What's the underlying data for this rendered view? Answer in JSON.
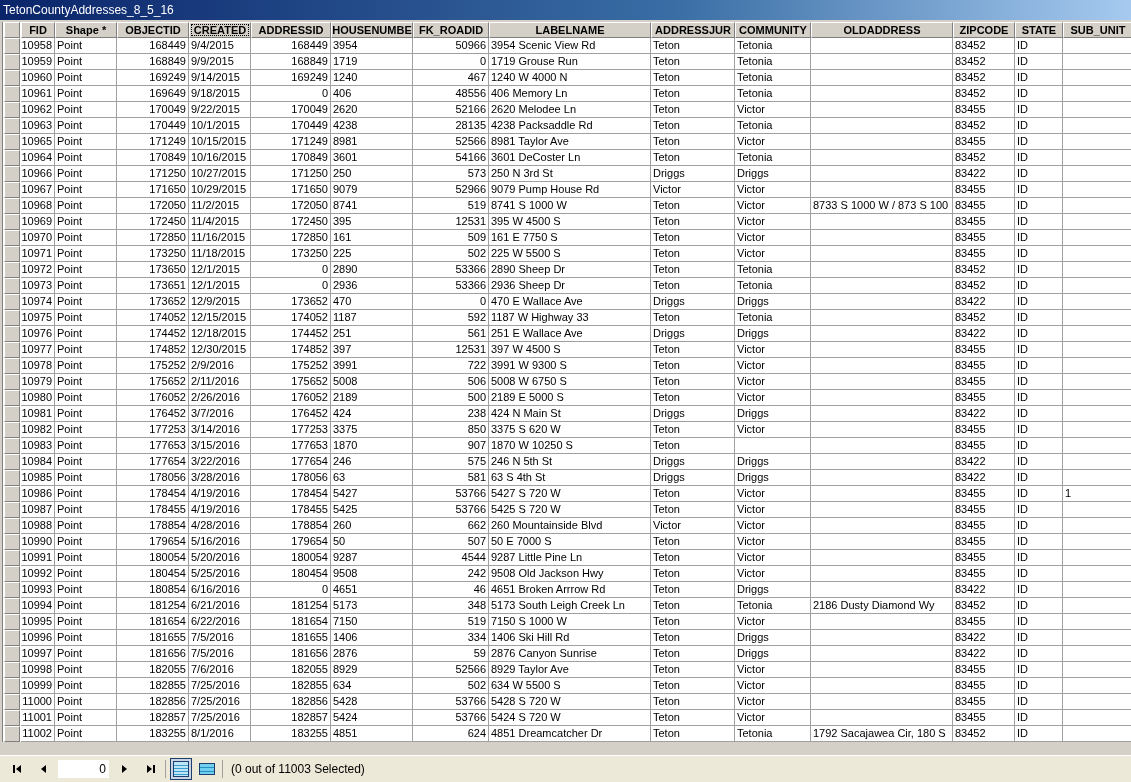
{
  "window": {
    "title": "TetonCountyAddresses_8_5_16"
  },
  "table": {
    "columns": [
      {
        "label": "FID",
        "kind": "number",
        "focused": false
      },
      {
        "label": "Shape *",
        "kind": "text",
        "focused": false
      },
      {
        "label": "OBJECTID",
        "kind": "number",
        "focused": false
      },
      {
        "label": "CREATED",
        "kind": "text",
        "focused": true
      },
      {
        "label": "ADDRESSID",
        "kind": "number",
        "focused": false
      },
      {
        "label": "HOUSENUMBE",
        "kind": "text",
        "focused": false
      },
      {
        "label": "FK_ROADID",
        "kind": "number",
        "focused": false
      },
      {
        "label": "LABELNAME",
        "kind": "text",
        "focused": false
      },
      {
        "label": "ADDRESSJUR",
        "kind": "text",
        "focused": false
      },
      {
        "label": "COMMUNITY",
        "kind": "text",
        "focused": false
      },
      {
        "label": "OLDADDRESS",
        "kind": "text",
        "focused": false
      },
      {
        "label": "ZIPCODE",
        "kind": "text",
        "focused": false
      },
      {
        "label": "STATE",
        "kind": "text",
        "focused": false
      },
      {
        "label": "SUB_UNIT",
        "kind": "text",
        "focused": false
      }
    ],
    "rows": [
      {
        "fid": "10958",
        "shape": "Point",
        "objectid": "168449",
        "created": "9/4/2015",
        "addressid": "168449",
        "housenumbe": "3954",
        "fk_roadid": "50966",
        "labelname": "3954 Scenic View Rd",
        "addressjur": "Teton",
        "community": "Tetonia",
        "zipcode": "83452",
        "state": "ID"
      },
      {
        "fid": "10959",
        "shape": "Point",
        "objectid": "168849",
        "created": "9/9/2015",
        "addressid": "168849",
        "housenumbe": "1719",
        "fk_roadid": "0",
        "labelname": "1719 Grouse Run",
        "addressjur": "Teton",
        "community": "Tetonia",
        "zipcode": "83452",
        "state": "ID"
      },
      {
        "fid": "10960",
        "shape": "Point",
        "objectid": "169249",
        "created": "9/14/2015",
        "addressid": "169249",
        "housenumbe": "1240",
        "fk_roadid": "467",
        "labelname": "1240 W 4000 N",
        "addressjur": "Teton",
        "community": "Tetonia",
        "zipcode": "83452",
        "state": "ID"
      },
      {
        "fid": "10961",
        "shape": "Point",
        "objectid": "169649",
        "created": "9/18/2015",
        "addressid": "0",
        "housenumbe": "406",
        "fk_roadid": "48556",
        "labelname": "406 Memory Ln",
        "addressjur": "Teton",
        "community": "Tetonia",
        "zipcode": "83452",
        "state": "ID"
      },
      {
        "fid": "10962",
        "shape": "Point",
        "objectid": "170049",
        "created": "9/22/2015",
        "addressid": "170049",
        "housenumbe": "2620",
        "fk_roadid": "52166",
        "labelname": "2620 Melodee Ln",
        "addressjur": "Teton",
        "community": "Victor",
        "zipcode": "83455",
        "state": "ID"
      },
      {
        "fid": "10963",
        "shape": "Point",
        "objectid": "170449",
        "created": "10/1/2015",
        "addressid": "170449",
        "housenumbe": "4238",
        "fk_roadid": "28135",
        "labelname": "4238 Packsaddle Rd",
        "addressjur": "Teton",
        "community": "Tetonia",
        "zipcode": "83452",
        "state": "ID"
      },
      {
        "fid": "10965",
        "shape": "Point",
        "objectid": "171249",
        "created": "10/15/2015",
        "addressid": "171249",
        "housenumbe": "8981",
        "fk_roadid": "52566",
        "labelname": "8981 Taylor Ave",
        "addressjur": "Teton",
        "community": "Victor",
        "zipcode": "83455",
        "state": "ID"
      },
      {
        "fid": "10964",
        "shape": "Point",
        "objectid": "170849",
        "created": "10/16/2015",
        "addressid": "170849",
        "housenumbe": "3601",
        "fk_roadid": "54166",
        "labelname": "3601 DeCoster Ln",
        "addressjur": "Teton",
        "community": "Tetonia",
        "zipcode": "83452",
        "state": "ID"
      },
      {
        "fid": "10966",
        "shape": "Point",
        "objectid": "171250",
        "created": "10/27/2015",
        "addressid": "171250",
        "housenumbe": "250",
        "fk_roadid": "573",
        "labelname": "250 N 3rd St",
        "addressjur": "Driggs",
        "community": "Driggs",
        "zipcode": "83422",
        "state": "ID"
      },
      {
        "fid": "10967",
        "shape": "Point",
        "objectid": "171650",
        "created": "10/29/2015",
        "addressid": "171650",
        "housenumbe": "9079",
        "fk_roadid": "52966",
        "labelname": "9079 Pump House Rd",
        "addressjur": "Victor",
        "community": "Victor",
        "zipcode": "83455",
        "state": "ID"
      },
      {
        "fid": "10968",
        "shape": "Point",
        "objectid": "172050",
        "created": "11/2/2015",
        "addressid": "172050",
        "housenumbe": "8741",
        "fk_roadid": "519",
        "labelname": "8741 S 1000 W",
        "addressjur": "Teton",
        "community": "Victor",
        "oldaddress": "8733 S 1000 W / 873 S 100",
        "zipcode": "83455",
        "state": "ID"
      },
      {
        "fid": "10969",
        "shape": "Point",
        "objectid": "172450",
        "created": "11/4/2015",
        "addressid": "172450",
        "housenumbe": "395",
        "fk_roadid": "12531",
        "labelname": "395 W 4500 S",
        "addressjur": "Teton",
        "community": "Victor",
        "zipcode": "83455",
        "state": "ID"
      },
      {
        "fid": "10970",
        "shape": "Point",
        "objectid": "172850",
        "created": "11/16/2015",
        "addressid": "172850",
        "housenumbe": "161",
        "fk_roadid": "509",
        "labelname": "161 E 7750 S",
        "addressjur": "Teton",
        "community": "Victor",
        "zipcode": "83455",
        "state": "ID"
      },
      {
        "fid": "10971",
        "shape": "Point",
        "objectid": "173250",
        "created": "11/18/2015",
        "addressid": "173250",
        "housenumbe": "225",
        "fk_roadid": "502",
        "labelname": "225 W 5500 S",
        "addressjur": "Teton",
        "community": "Victor",
        "zipcode": "83455",
        "state": "ID"
      },
      {
        "fid": "10972",
        "shape": "Point",
        "objectid": "173650",
        "created": "12/1/2015",
        "addressid": "0",
        "housenumbe": "2890",
        "fk_roadid": "53366",
        "labelname": "2890 Sheep Dr",
        "addressjur": "Teton",
        "community": "Tetonia",
        "zipcode": "83452",
        "state": "ID"
      },
      {
        "fid": "10973",
        "shape": "Point",
        "objectid": "173651",
        "created": "12/1/2015",
        "addressid": "0",
        "housenumbe": "2936",
        "fk_roadid": "53366",
        "labelname": "2936 Sheep Dr",
        "addressjur": "Teton",
        "community": "Tetonia",
        "zipcode": "83452",
        "state": "ID"
      },
      {
        "fid": "10974",
        "shape": "Point",
        "objectid": "173652",
        "created": "12/9/2015",
        "addressid": "173652",
        "housenumbe": "470",
        "fk_roadid": "0",
        "labelname": "470 E Wallace Ave",
        "addressjur": "Driggs",
        "community": "Driggs",
        "zipcode": "83422",
        "state": "ID"
      },
      {
        "fid": "10975",
        "shape": "Point",
        "objectid": "174052",
        "created": "12/15/2015",
        "addressid": "174052",
        "housenumbe": "1187",
        "fk_roadid": "592",
        "labelname": "1187 W Highway 33",
        "addressjur": "Teton",
        "community": "Tetonia",
        "zipcode": "83452",
        "state": "ID"
      },
      {
        "fid": "10976",
        "shape": "Point",
        "objectid": "174452",
        "created": "12/18/2015",
        "addressid": "174452",
        "housenumbe": "251",
        "fk_roadid": "561",
        "labelname": "251 E Wallace Ave",
        "addressjur": "Driggs",
        "community": "Driggs",
        "zipcode": "83422",
        "state": "ID"
      },
      {
        "fid": "10977",
        "shape": "Point",
        "objectid": "174852",
        "created": "12/30/2015",
        "addressid": "174852",
        "housenumbe": "397",
        "fk_roadid": "12531",
        "labelname": "397 W 4500 S",
        "addressjur": "Teton",
        "community": "Victor",
        "zipcode": "83455",
        "state": "ID"
      },
      {
        "fid": "10978",
        "shape": "Point",
        "objectid": "175252",
        "created": "2/9/2016",
        "addressid": "175252",
        "housenumbe": "3991",
        "fk_roadid": "722",
        "labelname": "3991 W 9300 S",
        "addressjur": "Teton",
        "community": "Victor",
        "zipcode": "83455",
        "state": "ID"
      },
      {
        "fid": "10979",
        "shape": "Point",
        "objectid": "175652",
        "created": "2/11/2016",
        "addressid": "175652",
        "housenumbe": "5008",
        "fk_roadid": "506",
        "labelname": "5008 W 6750 S",
        "addressjur": "Teton",
        "community": "Victor",
        "zipcode": "83455",
        "state": "ID"
      },
      {
        "fid": "10980",
        "shape": "Point",
        "objectid": "176052",
        "created": "2/26/2016",
        "addressid": "176052",
        "housenumbe": "2189",
        "fk_roadid": "500",
        "labelname": "2189 E 5000 S",
        "addressjur": "Teton",
        "community": "Victor",
        "zipcode": "83455",
        "state": "ID"
      },
      {
        "fid": "10981",
        "shape": "Point",
        "objectid": "176452",
        "created": "3/7/2016",
        "addressid": "176452",
        "housenumbe": "424",
        "fk_roadid": "238",
        "labelname": "424 N Main St",
        "addressjur": "Driggs",
        "community": "Driggs",
        "zipcode": "83422",
        "state": "ID"
      },
      {
        "fid": "10982",
        "shape": "Point",
        "objectid": "177253",
        "created": "3/14/2016",
        "addressid": "177253",
        "housenumbe": "3375",
        "fk_roadid": "850",
        "labelname": "3375 S 620 W",
        "addressjur": "Teton",
        "community": "Victor",
        "zipcode": "83455",
        "state": "ID"
      },
      {
        "fid": "10983",
        "shape": "Point",
        "objectid": "177653",
        "created": "3/15/2016",
        "addressid": "177653",
        "housenumbe": "1870",
        "fk_roadid": "907",
        "labelname": "1870 W 10250 S",
        "addressjur": "Teton",
        "zipcode": "83455",
        "state": "ID"
      },
      {
        "fid": "10984",
        "shape": "Point",
        "objectid": "177654",
        "created": "3/22/2016",
        "addressid": "177654",
        "housenumbe": "246",
        "fk_roadid": "575",
        "labelname": "246 N 5th St",
        "addressjur": "Driggs",
        "community": "Driggs",
        "zipcode": "83422",
        "state": "ID"
      },
      {
        "fid": "10985",
        "shape": "Point",
        "objectid": "178056",
        "created": "3/28/2016",
        "addressid": "178056",
        "housenumbe": "63",
        "fk_roadid": "581",
        "labelname": "63 S 4th St",
        "addressjur": "Driggs",
        "community": "Driggs",
        "zipcode": "83422",
        "state": "ID"
      },
      {
        "fid": "10986",
        "shape": "Point",
        "objectid": "178454",
        "created": "4/19/2016",
        "addressid": "178454",
        "housenumbe": "5427",
        "fk_roadid": "53766",
        "labelname": "5427 S 720 W",
        "addressjur": "Teton",
        "community": "Victor",
        "zipcode": "83455",
        "state": "ID",
        "sub_unit": "1"
      },
      {
        "fid": "10987",
        "shape": "Point",
        "objectid": "178455",
        "created": "4/19/2016",
        "addressid": "178455",
        "housenumbe": "5425",
        "fk_roadid": "53766",
        "labelname": "5425 S 720 W",
        "addressjur": "Teton",
        "community": "Victor",
        "zipcode": "83455",
        "state": "ID"
      },
      {
        "fid": "10988",
        "shape": "Point",
        "objectid": "178854",
        "created": "4/28/2016",
        "addressid": "178854",
        "housenumbe": "260",
        "fk_roadid": "662",
        "labelname": "260 Mountainside Blvd",
        "addressjur": "Victor",
        "community": "Victor",
        "zipcode": "83455",
        "state": "ID"
      },
      {
        "fid": "10990",
        "shape": "Point",
        "objectid": "179654",
        "created": "5/16/2016",
        "addressid": "179654",
        "housenumbe": "50",
        "fk_roadid": "507",
        "labelname": "50 E 7000 S",
        "addressjur": "Teton",
        "community": "Victor",
        "zipcode": "83455",
        "state": "ID"
      },
      {
        "fid": "10991",
        "shape": "Point",
        "objectid": "180054",
        "created": "5/20/2016",
        "addressid": "180054",
        "housenumbe": "9287",
        "fk_roadid": "4544",
        "labelname": "9287 Little Pine Ln",
        "addressjur": "Teton",
        "community": "Victor",
        "zipcode": "83455",
        "state": "ID"
      },
      {
        "fid": "10992",
        "shape": "Point",
        "objectid": "180454",
        "created": "5/25/2016",
        "addressid": "180454",
        "housenumbe": "9508",
        "fk_roadid": "242",
        "labelname": "9508 Old Jackson Hwy",
        "addressjur": "Teton",
        "community": "Victor",
        "zipcode": "83455",
        "state": "ID"
      },
      {
        "fid": "10993",
        "shape": "Point",
        "objectid": "180854",
        "created": "6/16/2016",
        "addressid": "0",
        "housenumbe": "4651",
        "fk_roadid": "46",
        "labelname": "4651 Broken Arrrow Rd",
        "addressjur": "Teton",
        "community": "Driggs",
        "zipcode": "83422",
        "state": "ID"
      },
      {
        "fid": "10994",
        "shape": "Point",
        "objectid": "181254",
        "created": "6/21/2016",
        "addressid": "181254",
        "housenumbe": "5173",
        "fk_roadid": "348",
        "labelname": "5173 South Leigh Creek Ln",
        "addressjur": "Teton",
        "community": "Tetonia",
        "oldaddress": "2186 Dusty Diamond Wy",
        "zipcode": "83452",
        "state": "ID"
      },
      {
        "fid": "10995",
        "shape": "Point",
        "objectid": "181654",
        "created": "6/22/2016",
        "addressid": "181654",
        "housenumbe": "7150",
        "fk_roadid": "519",
        "labelname": "7150 S 1000 W",
        "addressjur": "Teton",
        "community": "Victor",
        "zipcode": "83455",
        "state": "ID"
      },
      {
        "fid": "10996",
        "shape": "Point",
        "objectid": "181655",
        "created": "7/5/2016",
        "addressid": "181655",
        "housenumbe": "1406",
        "fk_roadid": "334",
        "labelname": "1406 Ski Hill Rd",
        "addressjur": "Teton",
        "community": "Driggs",
        "zipcode": "83422",
        "state": "ID"
      },
      {
        "fid": "10997",
        "shape": "Point",
        "objectid": "181656",
        "created": "7/5/2016",
        "addressid": "181656",
        "housenumbe": "2876",
        "fk_roadid": "59",
        "labelname": "2876 Canyon Sunrise",
        "addressjur": "Teton",
        "community": "Driggs",
        "zipcode": "83422",
        "state": "ID"
      },
      {
        "fid": "10998",
        "shape": "Point",
        "objectid": "182055",
        "created": "7/6/2016",
        "addressid": "182055",
        "housenumbe": "8929",
        "fk_roadid": "52566",
        "labelname": "8929 Taylor Ave",
        "addressjur": "Teton",
        "community": "Victor",
        "zipcode": "83455",
        "state": "ID"
      },
      {
        "fid": "10999",
        "shape": "Point",
        "objectid": "182855",
        "created": "7/25/2016",
        "addressid": "182855",
        "housenumbe": "634",
        "fk_roadid": "502",
        "labelname": "634 W 5500 S",
        "addressjur": "Teton",
        "community": "Victor",
        "zipcode": "83455",
        "state": "ID"
      },
      {
        "fid": "11000",
        "shape": "Point",
        "objectid": "182856",
        "created": "7/25/2016",
        "addressid": "182856",
        "housenumbe": "5428",
        "fk_roadid": "53766",
        "labelname": "5428 S 720 W",
        "addressjur": "Teton",
        "community": "Victor",
        "zipcode": "83455",
        "state": "ID"
      },
      {
        "fid": "11001",
        "shape": "Point",
        "objectid": "182857",
        "created": "7/25/2016",
        "addressid": "182857",
        "housenumbe": "5424",
        "fk_roadid": "53766",
        "labelname": "5424 S 720 W",
        "addressjur": "Teton",
        "community": "Victor",
        "zipcode": "83455",
        "state": "ID"
      },
      {
        "fid": "11002",
        "shape": "Point",
        "objectid": "183255",
        "created": "8/1/2016",
        "addressid": "183255",
        "housenumbe": "4851",
        "fk_roadid": "624",
        "labelname": "4851 Dreamcatcher Dr",
        "addressjur": "Teton",
        "community": "Tetonia",
        "oldaddress": "1792 Sacajawea Cir, 180 S",
        "zipcode": "83452",
        "state": "ID"
      }
    ]
  },
  "footer": {
    "record_field": {
      "value": "0"
    },
    "views": [
      {
        "selected": true
      },
      {
        "selected": false
      }
    ],
    "status": "(0 out of 11003 Selected)"
  }
}
